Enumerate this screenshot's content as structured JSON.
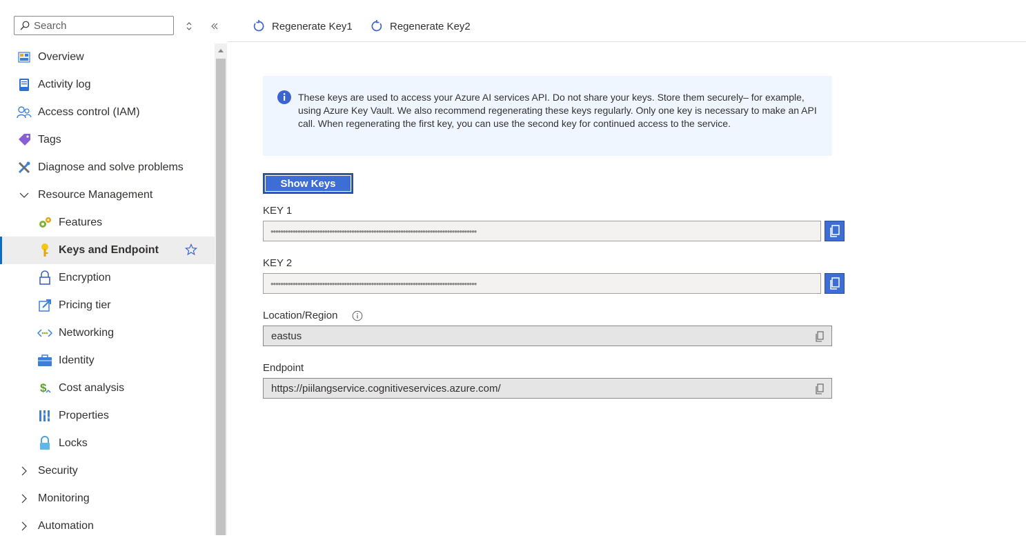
{
  "search": {
    "placeholder": "Search"
  },
  "sidebar": {
    "items": [
      {
        "label": "Overview",
        "icon": "overview-icon"
      },
      {
        "label": "Activity log",
        "icon": "activity-log-icon"
      },
      {
        "label": "Access control (IAM)",
        "icon": "people-icon"
      },
      {
        "label": "Tags",
        "icon": "tag-icon"
      },
      {
        "label": "Diagnose and solve problems",
        "icon": "wrench-icon"
      },
      {
        "label": "Resource Management",
        "icon": "chevron-down-icon"
      },
      {
        "label": "Features",
        "icon": "gears-icon"
      },
      {
        "label": "Keys and Endpoint",
        "icon": "key-icon"
      },
      {
        "label": "Encryption",
        "icon": "lock-icon"
      },
      {
        "label": "Pricing tier",
        "icon": "pricing-icon"
      },
      {
        "label": "Networking",
        "icon": "networking-icon"
      },
      {
        "label": "Identity",
        "icon": "identity-icon"
      },
      {
        "label": "Cost analysis",
        "icon": "cost-icon"
      },
      {
        "label": "Properties",
        "icon": "properties-icon"
      },
      {
        "label": "Locks",
        "icon": "locks-icon"
      },
      {
        "label": "Security",
        "icon": "chevron-right-icon"
      },
      {
        "label": "Monitoring",
        "icon": "chevron-right-icon"
      },
      {
        "label": "Automation",
        "icon": "chevron-right-icon"
      }
    ]
  },
  "toolbar": {
    "regen1": "Regenerate Key1",
    "regen2": "Regenerate Key2"
  },
  "info": {
    "text": "These keys are used to access your Azure AI services API. Do not share your keys. Store them securely– for example, using Azure Key Vault. We also recommend regenerating these keys regularly. Only one key is necessary to make an API call. When regenerating the first key, you can use the second key for continued access to the service."
  },
  "main": {
    "show_keys": "Show Keys",
    "key1_label": "KEY 1",
    "key1_value": "••••••••••••••••••••••••••••••••••••••••••••••••••••••••••••••••••••••••••••••••••••",
    "key2_label": "KEY 2",
    "key2_value": "••••••••••••••••••••••••••••••••••••••••••••••••••••••••••••••••••••••••••••••••••••",
    "location_label": "Location/Region",
    "location_value": "eastus",
    "endpoint_label": "Endpoint",
    "endpoint_value": "https://piilangservice.cognitiveservices.azure.com/"
  },
  "colors": {
    "accent": "#3c6ed6",
    "info_bg": "#f0f6ff",
    "active_bg": "#ededed"
  }
}
